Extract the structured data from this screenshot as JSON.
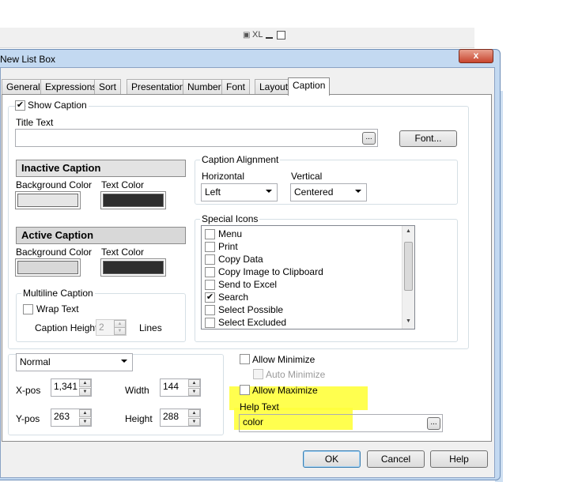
{
  "background_app": {
    "xl_label": "XL"
  },
  "dialog": {
    "title": "New List Box",
    "close_glyph": "x",
    "tabs": [
      {
        "label": "General"
      },
      {
        "label": "Expressions"
      },
      {
        "label": "Sort"
      },
      {
        "label": "Presentation"
      },
      {
        "label": "Number"
      },
      {
        "label": "Font"
      },
      {
        "label": "Layout"
      },
      {
        "label": "Caption",
        "active": true
      }
    ],
    "show_caption": {
      "label": "Show Caption",
      "checked": true
    },
    "title_text": {
      "label": "Title Text",
      "value": "",
      "browse": "...",
      "font_button": "Font..."
    },
    "inactive_caption": {
      "heading": "Inactive Caption",
      "bg_label": "Background Color",
      "text_label": "Text Color",
      "bg_color": "#e6e6e6",
      "text_color": "#2e2e2e"
    },
    "active_caption": {
      "heading": "Active Caption",
      "bg_label": "Background Color",
      "text_label": "Text Color",
      "bg_color": "#d8d8d8",
      "text_color": "#2e2e2e"
    },
    "caption_alignment": {
      "heading": "Caption Alignment",
      "horizontal_label": "Horizontal",
      "horizontal_value": "Left",
      "vertical_label": "Vertical",
      "vertical_value": "Centered"
    },
    "special_icons": {
      "heading": "Special Icons",
      "items": [
        {
          "label": "Menu",
          "checked": false
        },
        {
          "label": "Print",
          "checked": false
        },
        {
          "label": "Copy Data",
          "checked": false
        },
        {
          "label": "Copy Image to Clipboard",
          "checked": false
        },
        {
          "label": "Send to Excel",
          "checked": false
        },
        {
          "label": "Search",
          "checked": true
        },
        {
          "label": "Select Possible",
          "checked": false
        },
        {
          "label": "Select Excluded",
          "checked": false
        }
      ]
    },
    "multiline_caption": {
      "heading": "Multiline Caption",
      "wrap_text": "Wrap Text",
      "caption_height_label": "Caption Height",
      "caption_height_value": "2",
      "lines_label": "Lines"
    },
    "position": {
      "state_value": "Normal",
      "xpos_label": "X-pos",
      "xpos_value": "1,341",
      "ypos_label": "Y-pos",
      "ypos_value": "263",
      "width_label": "Width",
      "width_value": "144",
      "height_label": "Height",
      "height_value": "288"
    },
    "allow_minimize": "Allow Minimize",
    "auto_minimize": "Auto Minimize",
    "allow_maximize": "Allow Maximize",
    "help_text": {
      "label": "Help Text",
      "value": "color",
      "browse": "..."
    },
    "buttons": {
      "ok": "OK",
      "cancel": "Cancel",
      "help": "Help"
    },
    "highlight_color": "#ffff3c"
  }
}
